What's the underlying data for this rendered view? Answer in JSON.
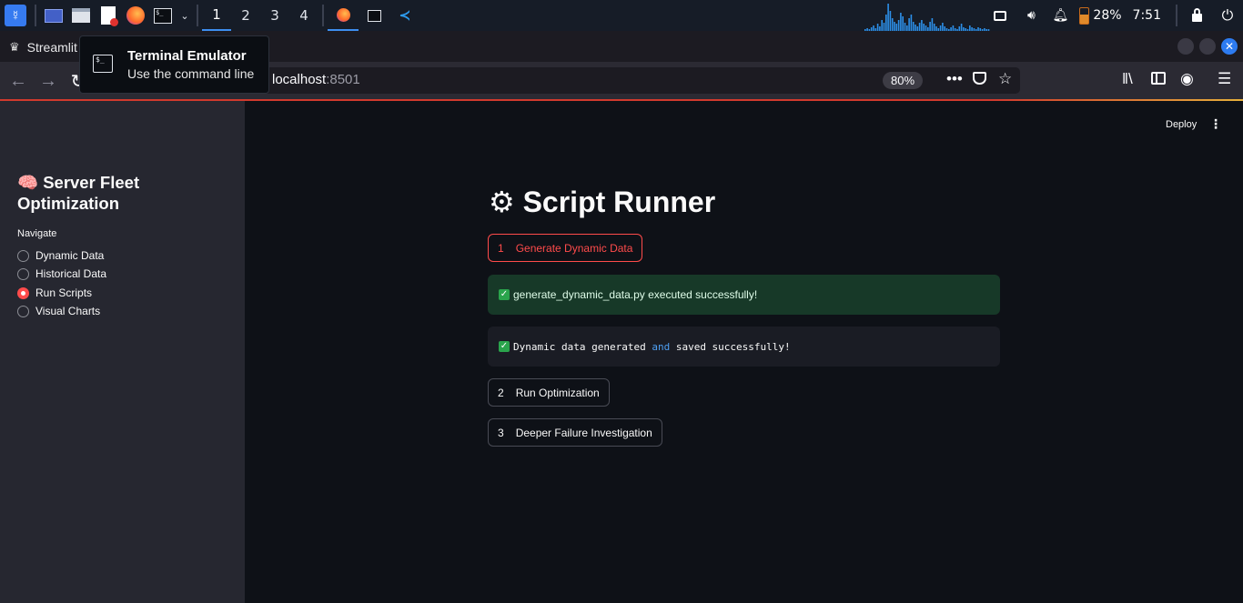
{
  "taskbar": {
    "workspaces": [
      "1",
      "2",
      "3",
      "4"
    ],
    "active_workspace": "1",
    "launchers": [
      "kali-menu-icon",
      "desktop-icon",
      "file-manager-icon",
      "text-editor-icon",
      "firefox-icon",
      "terminal-icon"
    ],
    "tray": {
      "battery_percent": "28%",
      "clock": "7:51"
    }
  },
  "browser": {
    "tab_title": "Streamlit",
    "url_host": "localhost",
    "url_port": ":8501",
    "zoom": "80%"
  },
  "tooltip": {
    "title": "Terminal Emulator",
    "description": "Use the command line"
  },
  "app": {
    "deploy_label": "Deploy",
    "sidebar": {
      "title_emoji": "🧠",
      "title": "Server Fleet Optimization",
      "nav_label": "Navigate",
      "options": [
        "Dynamic Data",
        "Historical Data",
        "Run Scripts",
        "Visual Charts"
      ],
      "selected": "Run Scripts"
    },
    "main": {
      "title_icon": "⚙",
      "title": "Script Runner",
      "buttons": [
        {
          "num": "1",
          "label": "Generate Dynamic Data"
        },
        {
          "num": "2",
          "label": "Run Optimization"
        },
        {
          "num": "3",
          "label": "Deeper Failure Investigation"
        }
      ],
      "success_message": "generate_dynamic_data.py executed successfully!",
      "output_pre": "Dynamic data generated ",
      "output_kw": "and",
      "output_post": " saved successfully!"
    }
  },
  "colors": {
    "accent": "#ff4b4b",
    "success_bg": "#173928",
    "sidebar_bg": "#262730",
    "main_bg": "#0e1117",
    "taskbar_highlight": "#3d8ef0"
  }
}
